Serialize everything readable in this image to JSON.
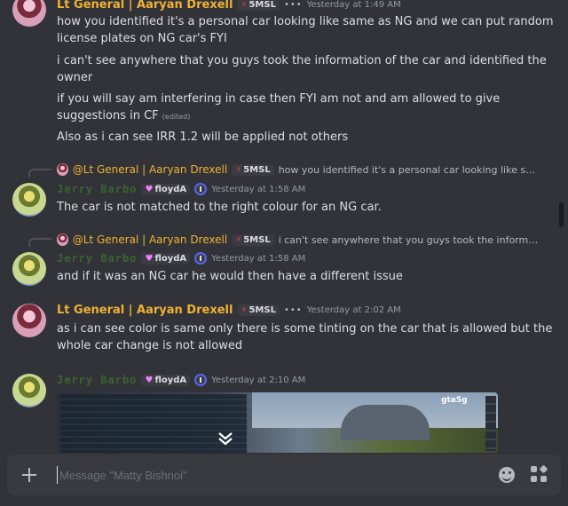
{
  "messages": {
    "m1": {
      "author": "Lt General | Aaryan Drexell",
      "tag": "5MSL",
      "timestamp": "Yesterday at 1:49 AM",
      "lines": [
        "how you identified it's a personal car looking like same as NG and we can put random license plates on NG car's FYI",
        "i can't see anywhere that you guys took the information of the car and identified the owner",
        "if you will say am interfering in case then FYI am not and am allowed to give suggestions in CF",
        "Also as i can see IRR 1.2 will be applied not others"
      ],
      "edited_label": "(edited)"
    },
    "m2": {
      "reply_author": "@Lt General | Aaryan Drexell",
      "reply_tag": "5MSL",
      "reply_text": "how you identified it's a personal car looking like same a...",
      "author": "Jerry Barbo",
      "tag": "floydA",
      "timestamp": "Yesterday at 1:58 AM",
      "text": "The car is not matched to the right colour for an NG car."
    },
    "m3": {
      "reply_author": "@Lt General | Aaryan Drexell",
      "reply_tag": "5MSL",
      "reply_text": "i can't see anywhere that you guys took the information ...",
      "author": "Jerry Barbo",
      "tag": "floydA",
      "timestamp": "Yesterday at 1:58 AM",
      "text": "and if it was an NG car he would then have a different issue"
    },
    "m4": {
      "author": "Lt General | Aaryan Drexell",
      "tag": "5MSL",
      "timestamp": "Yesterday at 2:02 AM",
      "text": "as i can see color is same only there is some tinting on the car that is allowed but the whole car change is not allowed"
    },
    "m5": {
      "author": "Jerry Barbo",
      "tag": "floydA",
      "timestamp": "Yesterday at 2:10 AM",
      "embed_label": "gta5g"
    }
  },
  "composer": {
    "placeholder": "Message \"Matty Bishnoi\""
  },
  "colors": {
    "background": "#313338",
    "role_gold": "#f0b132",
    "text": "#dbdee1",
    "muted": "#949ba4"
  }
}
